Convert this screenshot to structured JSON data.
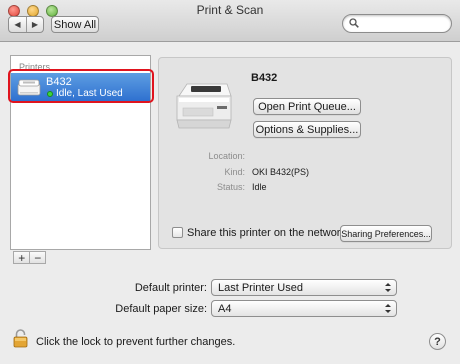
{
  "window": {
    "title": "Print & Scan"
  },
  "toolbar": {
    "back_glyph": "◀",
    "forward_glyph": "▶",
    "show_all_label": "Show All",
    "search_placeholder": ""
  },
  "printers_list": {
    "header": "Printers",
    "items": [
      {
        "name": "B432",
        "status": "Idle, Last Used",
        "selected": true
      }
    ],
    "add_label": "+",
    "remove_label": "−"
  },
  "details": {
    "printer_name": "B432",
    "open_queue_label": "Open Print Queue...",
    "options_label": "Options & Supplies...",
    "fields": [
      {
        "label": "Location:",
        "value": ""
      },
      {
        "label": "Kind:",
        "value": "OKI B432(PS)"
      },
      {
        "label": "Status:",
        "value": "Idle"
      }
    ],
    "share_label": "Share this printer on the network",
    "share_checked": false,
    "sharing_prefs_label": "Sharing Preferences..."
  },
  "defaults": {
    "printer_label": "Default printer:",
    "printer_value": "Last Printer Used",
    "paper_label": "Default paper size:",
    "paper_value": "A4"
  },
  "footer": {
    "lock_text": "Click the lock to prevent further changes.",
    "help_label": "?"
  },
  "colors": {
    "selection": "#3b7ed8",
    "highlight_outline": "#e0141e",
    "status_idle": "#3dd43d"
  }
}
